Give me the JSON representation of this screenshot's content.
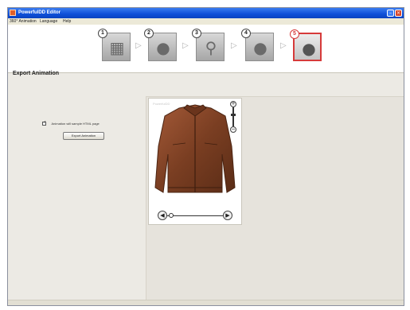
{
  "window": {
    "title": "PowerfulDD Editor",
    "minimize_glyph": "–",
    "close_glyph": "×"
  },
  "menu": {
    "items": [
      "360° Animation",
      "Language",
      "Help"
    ]
  },
  "steps": {
    "items": [
      {
        "number": "1",
        "icon": "image-icon",
        "glyph": "▦",
        "active": false
      },
      {
        "number": "2",
        "icon": "person-icon",
        "glyph": "●",
        "active": false
      },
      {
        "number": "3",
        "icon": "magnifier-icon",
        "glyph": "⚲",
        "active": false
      },
      {
        "number": "4",
        "icon": "person-settings-icon",
        "glyph": "●",
        "active": false
      },
      {
        "number": "5",
        "icon": "person-export-icon",
        "glyph": "●",
        "active": true
      }
    ],
    "arrow_glyph": "▷",
    "accent_color": "#d63a3a"
  },
  "export": {
    "title": "Export Animation",
    "checkbox_label": "Animation will sample HTML page",
    "checkbox_checked": true,
    "button_label": "Export Animation"
  },
  "preview": {
    "watermark": "PowerfulDD",
    "zoom_in_glyph": "+",
    "zoom_out_glyph": "−",
    "prev_glyph": "◀",
    "next_glyph": "▶",
    "zoom_level": 0.5,
    "rotation_position": 0.05
  }
}
